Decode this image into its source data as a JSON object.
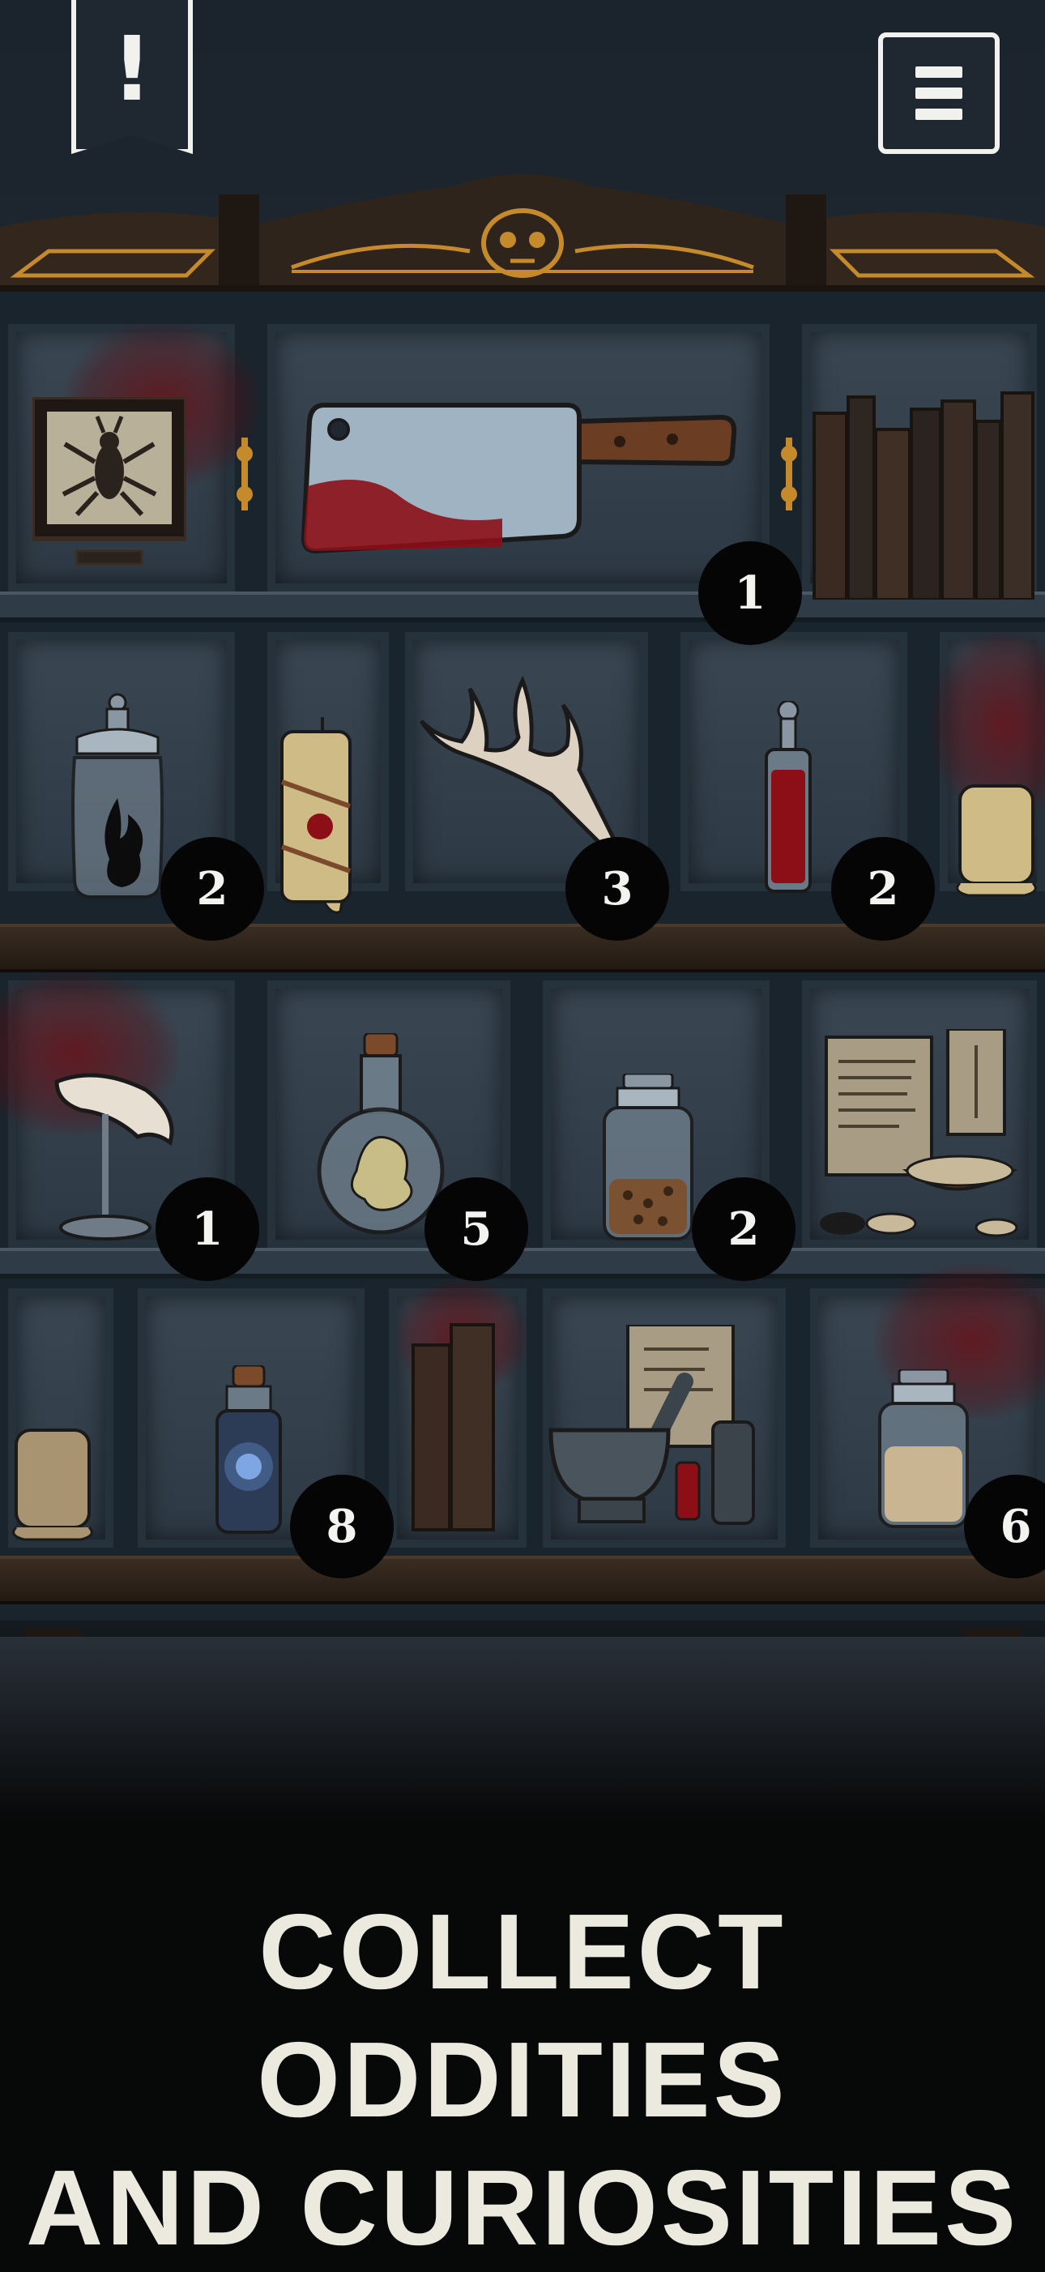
{
  "icons": {
    "alert": "exclamation-bookmark-icon",
    "menu": "hamburger-menu-icon"
  },
  "alert_glyph": "!",
  "shelf_counts": [
    {
      "id": "cleaver",
      "count": "1"
    },
    {
      "id": "flame-jar",
      "count": "2"
    },
    {
      "id": "antler",
      "count": "3"
    },
    {
      "id": "blood-vial",
      "count": "2"
    },
    {
      "id": "tooth-stand",
      "count": "1"
    },
    {
      "id": "specimen-flask",
      "count": "5"
    },
    {
      "id": "seed-jar",
      "count": "2"
    },
    {
      "id": "blue-light-bottle",
      "count": "8"
    },
    {
      "id": "powder-jar",
      "count": "6"
    }
  ],
  "headline": {
    "line1": "COLLECT ODDITIES",
    "line2": "AND CURIOSITIES"
  },
  "colors": {
    "headline": "#ece9df",
    "badge": "#050505",
    "blood": "#8c0f18",
    "gold_trim": "#c58a2c"
  }
}
